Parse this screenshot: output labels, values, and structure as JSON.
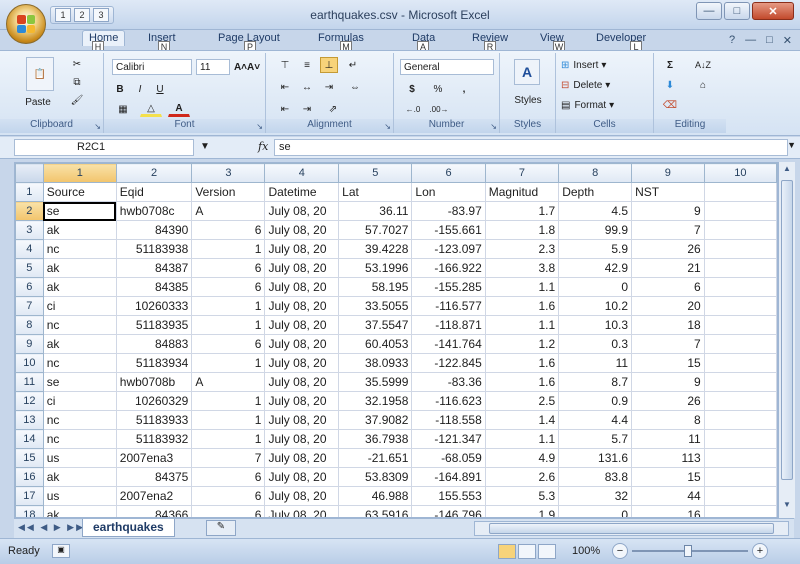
{
  "window": {
    "title": "earthquakes.csv - Microsoft Excel",
    "minimize": "—",
    "restore": "□",
    "close": "✕"
  },
  "qat": {
    "keytip1": "1",
    "keytip2": "2",
    "keytip3": "3"
  },
  "ribbon_tabs": [
    {
      "label": "Home",
      "keytip": "H"
    },
    {
      "label": "Insert",
      "keytip": "N"
    },
    {
      "label": "Page Layout",
      "keytip": "P"
    },
    {
      "label": "Formulas",
      "keytip": "M"
    },
    {
      "label": "Data",
      "keytip": "A"
    },
    {
      "label": "Review",
      "keytip": "R"
    },
    {
      "label": "View",
      "keytip": "W"
    },
    {
      "label": "Developer",
      "keytip": "L"
    }
  ],
  "ribbon": {
    "clipboard": {
      "label": "Clipboard",
      "paste": "Paste"
    },
    "font": {
      "label": "Font",
      "name": "Calibri",
      "size": "11",
      "bold": "B",
      "italic": "I",
      "underline": "U",
      "grow": "A˄",
      "shrink": "A˅"
    },
    "alignment": {
      "label": "Alignment"
    },
    "number": {
      "label": "Number",
      "format": "General",
      "currency": "$",
      "percent": "%",
      "comma": ","
    },
    "styles": {
      "label": "Styles",
      "button": "Styles"
    },
    "cells": {
      "label": "Cells",
      "insert": "Insert",
      "delete": "Delete",
      "format": "Format"
    },
    "editing": {
      "label": "Editing",
      "sum": "Σ",
      "sort": "A↓Z",
      "find": "⌂"
    }
  },
  "formula_bar": {
    "namebox": "R2C1",
    "fx": "fx",
    "content": "se"
  },
  "columns": [
    "1",
    "2",
    "3",
    "4",
    "5",
    "6",
    "7",
    "8",
    "9",
    "10"
  ],
  "rows": [
    [
      "Source",
      "Eqid",
      "Version",
      "Datetime",
      "Lat",
      "Lon",
      "Magnitud",
      "Depth",
      "NST",
      ""
    ],
    [
      "se",
      "hwb0708c",
      "A",
      "July 08, 20",
      "36.11",
      "-83.97",
      "1.7",
      "4.5",
      "9",
      ""
    ],
    [
      "ak",
      "84390",
      "6",
      "July 08, 20",
      "57.7027",
      "-155.661",
      "1.8",
      "99.9",
      "7",
      ""
    ],
    [
      "nc",
      "51183938",
      "1",
      "July 08, 20",
      "39.4228",
      "-123.097",
      "2.3",
      "5.9",
      "26",
      ""
    ],
    [
      "ak",
      "84387",
      "6",
      "July 08, 20",
      "53.1996",
      "-166.922",
      "3.8",
      "42.9",
      "21",
      ""
    ],
    [
      "ak",
      "84385",
      "6",
      "July 08, 20",
      "58.195",
      "-155.285",
      "1.1",
      "0",
      "6",
      ""
    ],
    [
      "ci",
      "10260333",
      "1",
      "July 08, 20",
      "33.5055",
      "-116.577",
      "1.6",
      "10.2",
      "20",
      ""
    ],
    [
      "nc",
      "51183935",
      "1",
      "July 08, 20",
      "37.5547",
      "-118.871",
      "1.1",
      "10.3",
      "18",
      ""
    ],
    [
      "ak",
      "84883",
      "6",
      "July 08, 20",
      "60.4053",
      "-141.764",
      "1.2",
      "0.3",
      "7",
      ""
    ],
    [
      "nc",
      "51183934",
      "1",
      "July 08, 20",
      "38.0933",
      "-122.845",
      "1.6",
      "11",
      "15",
      ""
    ],
    [
      "se",
      "hwb0708b",
      "A",
      "July 08, 20",
      "35.5999",
      "-83.36",
      "1.6",
      "8.7",
      "9",
      ""
    ],
    [
      "ci",
      "10260329",
      "1",
      "July 08, 20",
      "32.1958",
      "-116.623",
      "2.5",
      "0.9",
      "26",
      ""
    ],
    [
      "nc",
      "51183933",
      "1",
      "July 08, 20",
      "37.9082",
      "-118.558",
      "1.4",
      "4.4",
      "8",
      ""
    ],
    [
      "nc",
      "51183932",
      "1",
      "July 08, 20",
      "36.7938",
      "-121.347",
      "1.1",
      "5.7",
      "11",
      ""
    ],
    [
      "us",
      "2007ena3",
      "7",
      "July 08, 20",
      "-21.651",
      "-68.059",
      "4.9",
      "131.6",
      "113",
      ""
    ],
    [
      "ak",
      "84375",
      "6",
      "July 08, 20",
      "53.8309",
      "-164.891",
      "2.6",
      "83.8",
      "15",
      ""
    ],
    [
      "us",
      "2007ena2",
      "6",
      "July 08, 20",
      "46.988",
      "155.553",
      "5.3",
      "32",
      "44",
      ""
    ],
    [
      "ak",
      "84366",
      "6",
      "July 08, 20",
      "63.5916",
      "-146.796",
      "1.9",
      "0",
      "16",
      ""
    ]
  ],
  "row_numbers": [
    "1",
    "2",
    "3",
    "4",
    "5",
    "6",
    "7",
    "8",
    "9",
    "10",
    "11",
    "12",
    "13",
    "14",
    "15",
    "16",
    "17",
    "18"
  ],
  "sheet_tab": "earthquakes",
  "status": {
    "ready": "Ready",
    "zoom": "100%",
    "zoom_minus": "−",
    "zoom_plus": "+"
  }
}
